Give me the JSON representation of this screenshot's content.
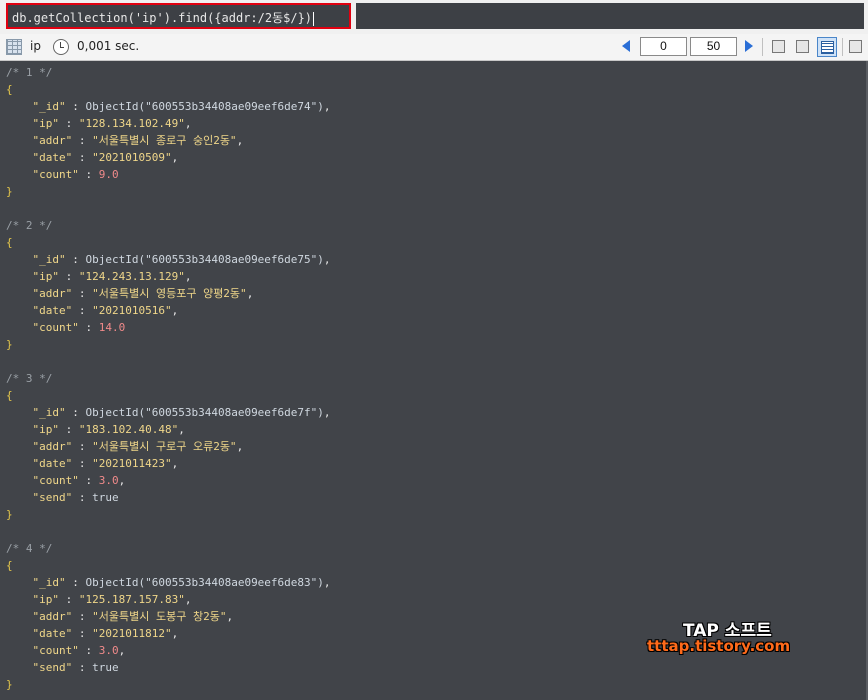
{
  "query": {
    "text": "db.getCollection('ip').find({addr:/2동$/})"
  },
  "toolbar": {
    "collection": "ip",
    "time": "0,001 sec.",
    "skip": "0",
    "limit": "50"
  },
  "documents": [
    {
      "comment": "/* 1 */",
      "id": "ObjectId(\"600553b34408ae09eef6de74\")",
      "ip": "\"128.134.102.49\"",
      "addr": "\"서울특별시 종로구 숭인2동\"",
      "date": "\"2021010509\"",
      "count": "9.0"
    },
    {
      "comment": "/* 2 */",
      "id": "ObjectId(\"600553b34408ae09eef6de75\")",
      "ip": "\"124.243.13.129\"",
      "addr": "\"서울특별시 영등포구 양평2동\"",
      "date": "\"2021010516\"",
      "count": "14.0"
    },
    {
      "comment": "/* 3 */",
      "id": "ObjectId(\"600553b34408ae09eef6de7f\")",
      "ip": "\"183.102.40.48\"",
      "addr": "\"서울특별시 구로구 오류2동\"",
      "date": "\"2021011423\"",
      "count": "3.0",
      "send": "true"
    },
    {
      "comment": "/* 4 */",
      "id": "ObjectId(\"600553b34408ae09eef6de83\")",
      "ip": "\"125.187.157.83\"",
      "addr": "\"서울특별시 도봉구 창2동\"",
      "date": "\"2021011812\"",
      "count": "3.0",
      "send": "true"
    }
  ],
  "keys": {
    "id": "\"_id\"",
    "ip": "\"ip\"",
    "addr": "\"addr\"",
    "date": "\"date\"",
    "count": "\"count\"",
    "send": "\"send\""
  },
  "watermark": {
    "line1": "TAP 소프트",
    "line2": "tttap.tistory.com"
  }
}
